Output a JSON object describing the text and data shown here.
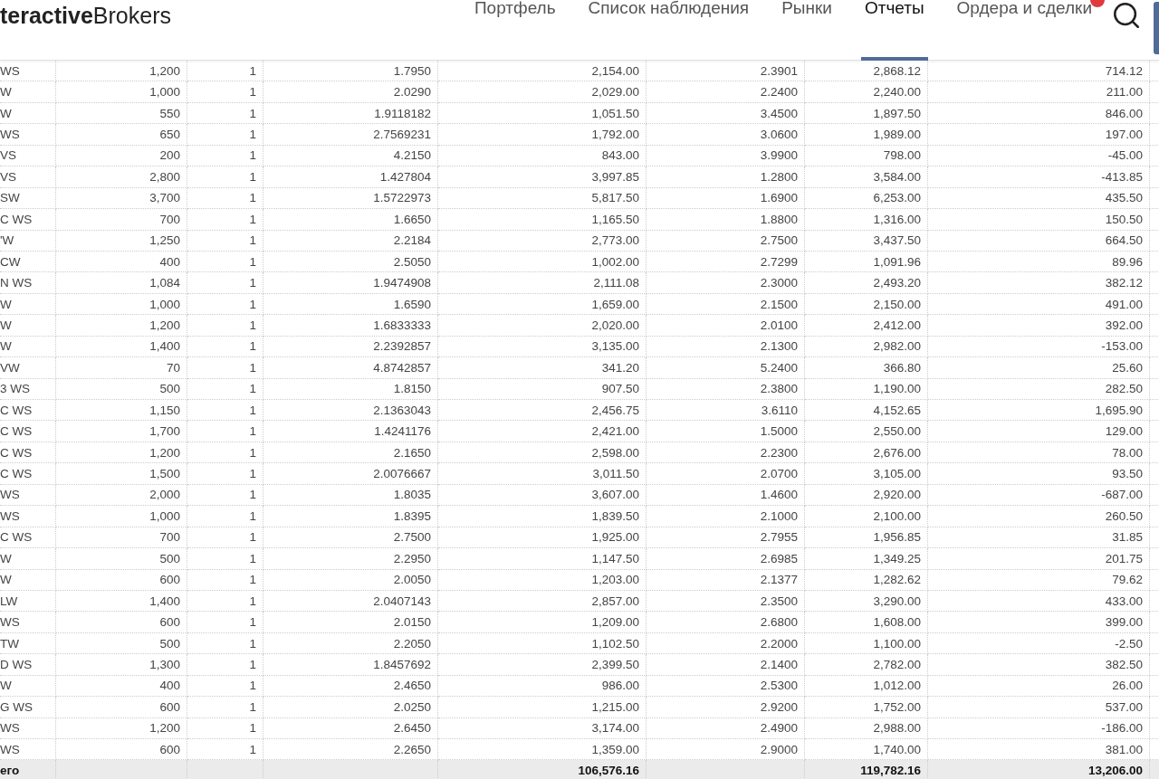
{
  "header": {
    "logo_bold": "teractive",
    "logo_regular": "Brokers",
    "nav": [
      {
        "label": "Портфель",
        "selected": false
      },
      {
        "label": "Список наблюдения",
        "selected": false
      },
      {
        "label": "Рынки",
        "selected": false
      },
      {
        "label": "Отчеты",
        "selected": true
      },
      {
        "label": "Ордера и сделки",
        "selected": false,
        "badge": true
      }
    ]
  },
  "table": {
    "rows": [
      [
        "WS",
        "1,200",
        "1",
        "1.7950",
        "2,154.00",
        "2.3901",
        "2,868.12",
        "714.12"
      ],
      [
        "W",
        "1,000",
        "1",
        "2.0290",
        "2,029.00",
        "2.2400",
        "2,240.00",
        "211.00"
      ],
      [
        "W",
        "550",
        "1",
        "1.9118182",
        "1,051.50",
        "3.4500",
        "1,897.50",
        "846.00"
      ],
      [
        "WS",
        "650",
        "1",
        "2.7569231",
        "1,792.00",
        "3.0600",
        "1,989.00",
        "197.00"
      ],
      [
        "VS",
        "200",
        "1",
        "4.2150",
        "843.00",
        "3.9900",
        "798.00",
        "-45.00"
      ],
      [
        "VS",
        "2,800",
        "1",
        "1.427804",
        "3,997.85",
        "1.2800",
        "3,584.00",
        "-413.85"
      ],
      [
        "SW",
        "3,700",
        "1",
        "1.5722973",
        "5,817.50",
        "1.6900",
        "6,253.00",
        "435.50"
      ],
      [
        "C WS",
        "700",
        "1",
        "1.6650",
        "1,165.50",
        "1.8800",
        "1,316.00",
        "150.50"
      ],
      [
        "'W",
        "1,250",
        "1",
        "2.2184",
        "2,773.00",
        "2.7500",
        "3,437.50",
        "664.50"
      ],
      [
        "CW",
        "400",
        "1",
        "2.5050",
        "1,002.00",
        "2.7299",
        "1,091.96",
        "89.96"
      ],
      [
        "N WS",
        "1,084",
        "1",
        "1.9474908",
        "2,111.08",
        "2.3000",
        "2,493.20",
        "382.12"
      ],
      [
        "W",
        "1,000",
        "1",
        "1.6590",
        "1,659.00",
        "2.1500",
        "2,150.00",
        "491.00"
      ],
      [
        "W",
        "1,200",
        "1",
        "1.6833333",
        "2,020.00",
        "2.0100",
        "2,412.00",
        "392.00"
      ],
      [
        "W",
        "1,400",
        "1",
        "2.2392857",
        "3,135.00",
        "2.1300",
        "2,982.00",
        "-153.00"
      ],
      [
        "VW",
        "70",
        "1",
        "4.8742857",
        "341.20",
        "5.2400",
        "366.80",
        "25.60"
      ],
      [
        "3 WS",
        "500",
        "1",
        "1.8150",
        "907.50",
        "2.3800",
        "1,190.00",
        "282.50"
      ],
      [
        "C WS",
        "1,150",
        "1",
        "2.1363043",
        "2,456.75",
        "3.6110",
        "4,152.65",
        "1,695.90"
      ],
      [
        "C WS",
        "1,700",
        "1",
        "1.4241176",
        "2,421.00",
        "1.5000",
        "2,550.00",
        "129.00"
      ],
      [
        "C WS",
        "1,200",
        "1",
        "2.1650",
        "2,598.00",
        "2.2300",
        "2,676.00",
        "78.00"
      ],
      [
        "C WS",
        "1,500",
        "1",
        "2.0076667",
        "3,011.50",
        "2.0700",
        "3,105.00",
        "93.50"
      ],
      [
        "WS",
        "2,000",
        "1",
        "1.8035",
        "3,607.00",
        "1.4600",
        "2,920.00",
        "-687.00"
      ],
      [
        "WS",
        "1,000",
        "1",
        "1.8395",
        "1,839.50",
        "2.1000",
        "2,100.00",
        "260.50"
      ],
      [
        "C WS",
        "700",
        "1",
        "2.7500",
        "1,925.00",
        "2.7955",
        "1,956.85",
        "31.85"
      ],
      [
        "W",
        "500",
        "1",
        "2.2950",
        "1,147.50",
        "2.6985",
        "1,349.25",
        "201.75"
      ],
      [
        "W",
        "600",
        "1",
        "2.0050",
        "1,203.00",
        "2.1377",
        "1,282.62",
        "79.62"
      ],
      [
        "LW",
        "1,400",
        "1",
        "2.0407143",
        "2,857.00",
        "2.3500",
        "3,290.00",
        "433.00"
      ],
      [
        "WS",
        "600",
        "1",
        "2.0150",
        "1,209.00",
        "2.6800",
        "1,608.00",
        "399.00"
      ],
      [
        "TW",
        "500",
        "1",
        "2.2050",
        "1,102.50",
        "2.2000",
        "1,100.00",
        "-2.50"
      ],
      [
        "D WS",
        "1,300",
        "1",
        "1.8457692",
        "2,399.50",
        "2.1400",
        "2,782.00",
        "382.50"
      ],
      [
        "W",
        "400",
        "1",
        "2.4650",
        "986.00",
        "2.5300",
        "1,012.00",
        "26.00"
      ],
      [
        "G WS",
        "600",
        "1",
        "2.0250",
        "1,215.00",
        "2.9200",
        "1,752.00",
        "537.00"
      ],
      [
        "WS",
        "1,200",
        "1",
        "2.6450",
        "3,174.00",
        "2.4900",
        "2,988.00",
        "-186.00"
      ],
      [
        "WS",
        "600",
        "1",
        "2.2650",
        "1,359.00",
        "2.9000",
        "1,740.00",
        "381.00"
      ]
    ],
    "total": {
      "label": "его",
      "cost": "106,576.16",
      "value": "119,782.16",
      "pnl": "13,206.00"
    }
  }
}
